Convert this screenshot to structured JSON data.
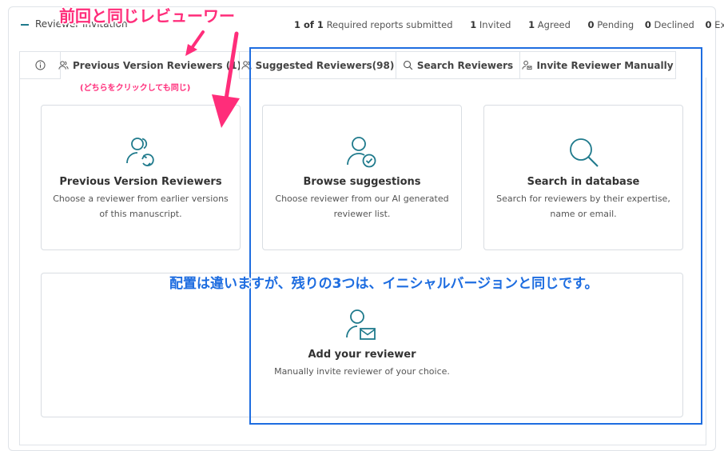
{
  "section": {
    "title": "Reviewer Invitation"
  },
  "stats": {
    "submitted_count": "1 of 1",
    "submitted_label": "Required reports submitted",
    "invited_count": "1",
    "invited_label": "Invited",
    "agreed_count": "1",
    "agreed_label": "Agreed",
    "pending_count": "0",
    "pending_label": "Pending",
    "declined_count": "0",
    "declined_label": "Declined",
    "expired_count": "0",
    "expired_label": "Expired"
  },
  "tabs": {
    "previous": "Previous Version Reviewers (1)",
    "suggested": "Suggested Reviewers(98)",
    "search": "Search Reviewers",
    "invite": "Invite Reviewer Manually"
  },
  "cards": {
    "previous": {
      "title": "Previous Version Reviewers",
      "desc": "Choose a reviewer from earlier versions of this manuscript."
    },
    "browse": {
      "title": "Browse suggestions",
      "desc": "Choose reviewer from our AI generated reviewer list."
    },
    "search": {
      "title": "Search in database",
      "desc": "Search for reviewers by their expertise, name or email."
    },
    "add": {
      "title": "Add your reviewer",
      "desc": "Manually invite reviewer of your choice."
    }
  },
  "annotations": {
    "top": "前回と同じレビューワー",
    "small": "(どちらをクリックしても同じ)",
    "blue": "配置は違いますが、残りの3つは、イニシャルバージョンと同じです。"
  },
  "colors": {
    "accent": "#1f7a8c",
    "annotation_pink": "#ff2d7a",
    "annotation_blue": "#1e6de0"
  }
}
